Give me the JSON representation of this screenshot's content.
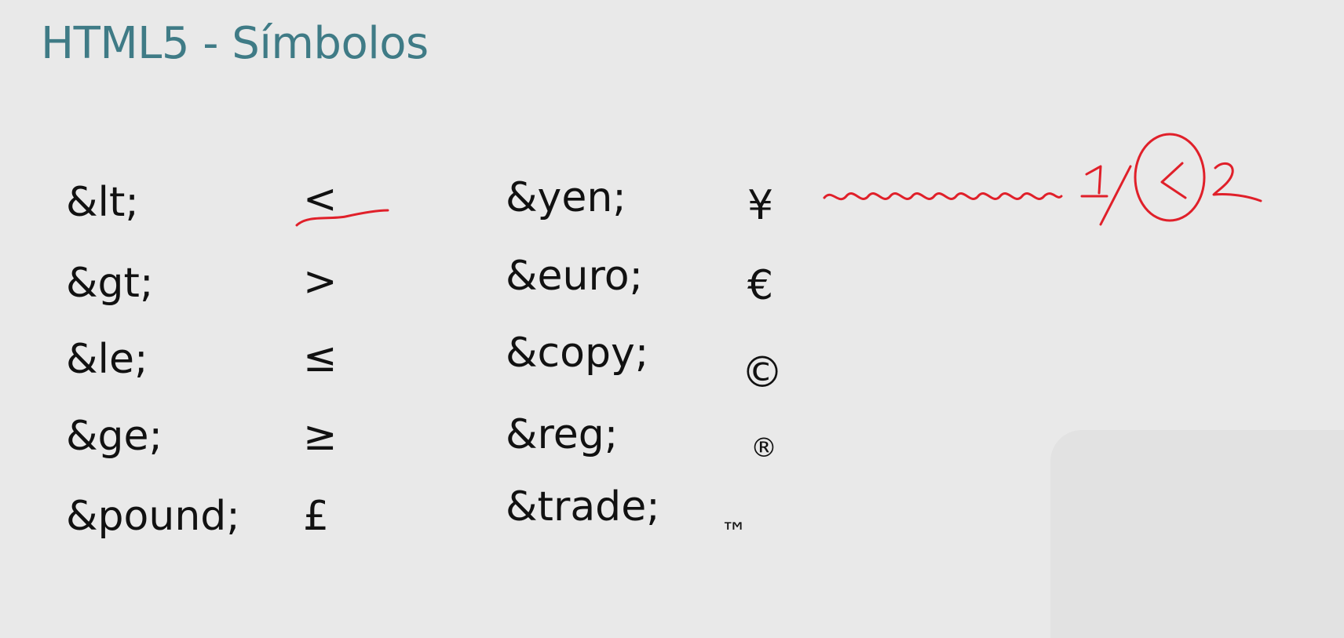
{
  "slide": {
    "title": "HTML5 - Símbolos",
    "left_column": [
      {
        "entity": "&lt;",
        "symbol": "<"
      },
      {
        "entity": "&gt;",
        "symbol": ">"
      },
      {
        "entity": "&le;",
        "symbol": "≤"
      },
      {
        "entity": "&ge;",
        "symbol": "≥"
      },
      {
        "entity": "&pound;",
        "symbol": "£"
      }
    ],
    "right_column": [
      {
        "entity": "&yen;",
        "symbol": "¥"
      },
      {
        "entity": "&euro;",
        "symbol": "€"
      },
      {
        "entity": "&copy;",
        "symbol": "©"
      },
      {
        "entity": "&reg;",
        "symbol": "®"
      },
      {
        "entity": "&trade;",
        "symbol": "™"
      }
    ]
  },
  "colors": {
    "title": "#3f7b86",
    "ink_annotation": "#e0202a",
    "background": "#e9e9e9"
  }
}
